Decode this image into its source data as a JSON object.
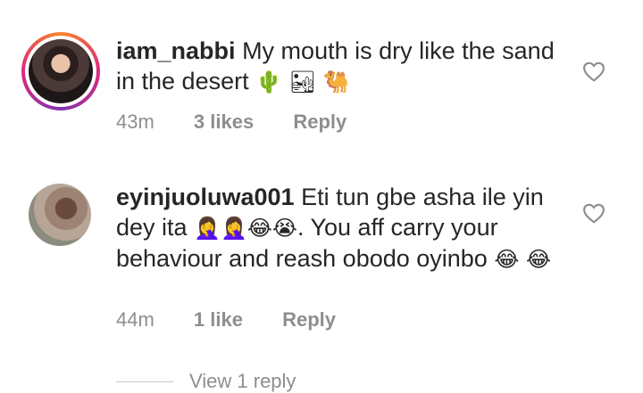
{
  "comments": [
    {
      "username": "iam_nabbi",
      "text": "My mouth is dry like the sand in the desert",
      "emojis": "🌵 🏜 🐫",
      "time": "43m",
      "likes": "3 likes",
      "reply": "Reply"
    },
    {
      "username": "eyinjuoluwa001",
      "text": "Eti tun gbe asha ile yin dey ita",
      "emojis_1": "🤦‍♀️🤦‍♀️😂😭",
      "text_2": ". You aff carry your behaviour and reash obodo oyinbo",
      "emojis_2": "😂 😂",
      "time": "44m",
      "likes": "1 like",
      "reply": "Reply"
    }
  ],
  "view_replies": "View 1 reply"
}
